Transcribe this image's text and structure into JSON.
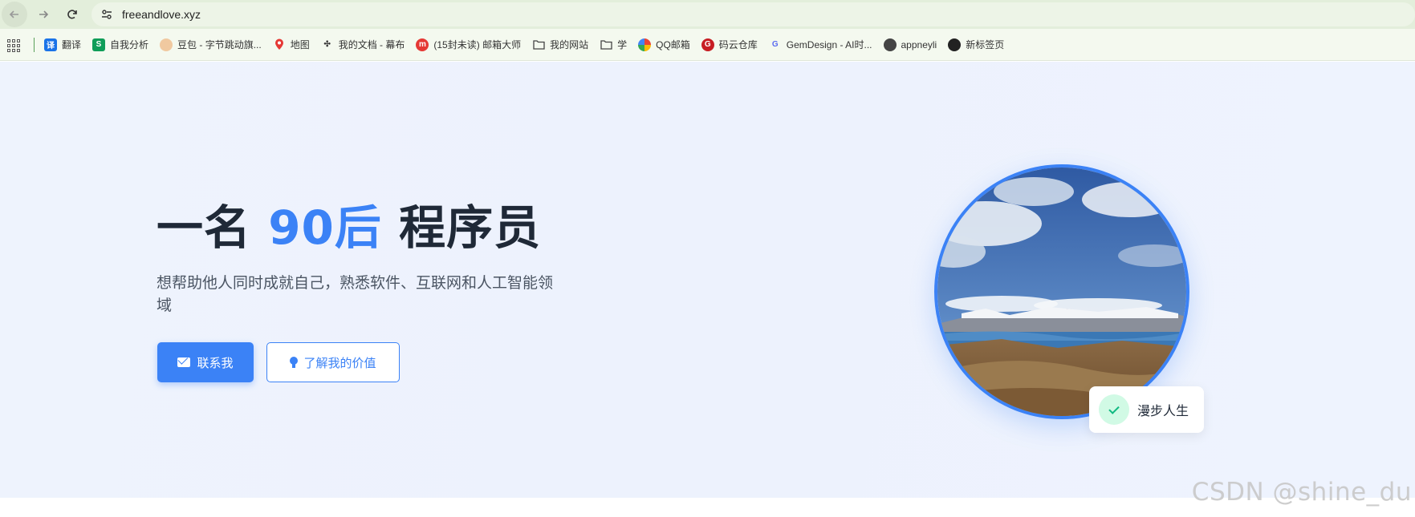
{
  "browser": {
    "url": "freeandlove.xyz"
  },
  "bookmarks": [
    {
      "label": "翻译",
      "icon": "translate-icon",
      "color": "#1a73e8",
      "glyph": "译"
    },
    {
      "label": "自我分析",
      "icon": "sheets-icon",
      "color": "#0f9d58",
      "glyph": "S"
    },
    {
      "label": "豆包 - 字节跳动旗...",
      "icon": "doubao-icon",
      "color": "#f0c9a0",
      "glyph": "豆"
    },
    {
      "label": "地图",
      "icon": "map-pin-icon",
      "color": "#e53935",
      "glyph": ""
    },
    {
      "label": "我的文档 - 幕布",
      "icon": "mubu-icon",
      "color": "#333333",
      "glyph": "✣"
    },
    {
      "label": "(15封未读) 邮箱大师",
      "icon": "mail-master-icon",
      "color": "#e53935",
      "glyph": "m"
    },
    {
      "label": "我的网站",
      "icon": "folder-icon",
      "color": "",
      "glyph": ""
    },
    {
      "label": "学",
      "icon": "folder-icon",
      "color": "",
      "glyph": ""
    },
    {
      "label": "QQ邮箱",
      "icon": "qqmail-icon",
      "color": "#f4b400",
      "glyph": ""
    },
    {
      "label": "码云仓库",
      "icon": "gitee-icon",
      "color": "#c71d23",
      "glyph": "G"
    },
    {
      "label": "GemDesign - AI时...",
      "icon": "gemdesign-icon",
      "color": "#ffffff",
      "glyph": "G"
    },
    {
      "label": "appneyli",
      "icon": "globe-icon",
      "color": "#444444",
      "glyph": ""
    },
    {
      "label": "新标签页",
      "icon": "github-icon",
      "color": "#222222",
      "glyph": ""
    }
  ],
  "hero": {
    "title_prefix": "一名 ",
    "title_accent": "90后",
    "title_suffix": " 程序员",
    "subtitle": "想帮助他人同时成就自己，熟悉软件、互联网和人工智能领域",
    "contact_label": "联系我",
    "learn_label": "了解我的价值",
    "badge_label": "漫步人生",
    "accent_color": "#3b82f6"
  },
  "watermark": "CSDN @shine_du"
}
